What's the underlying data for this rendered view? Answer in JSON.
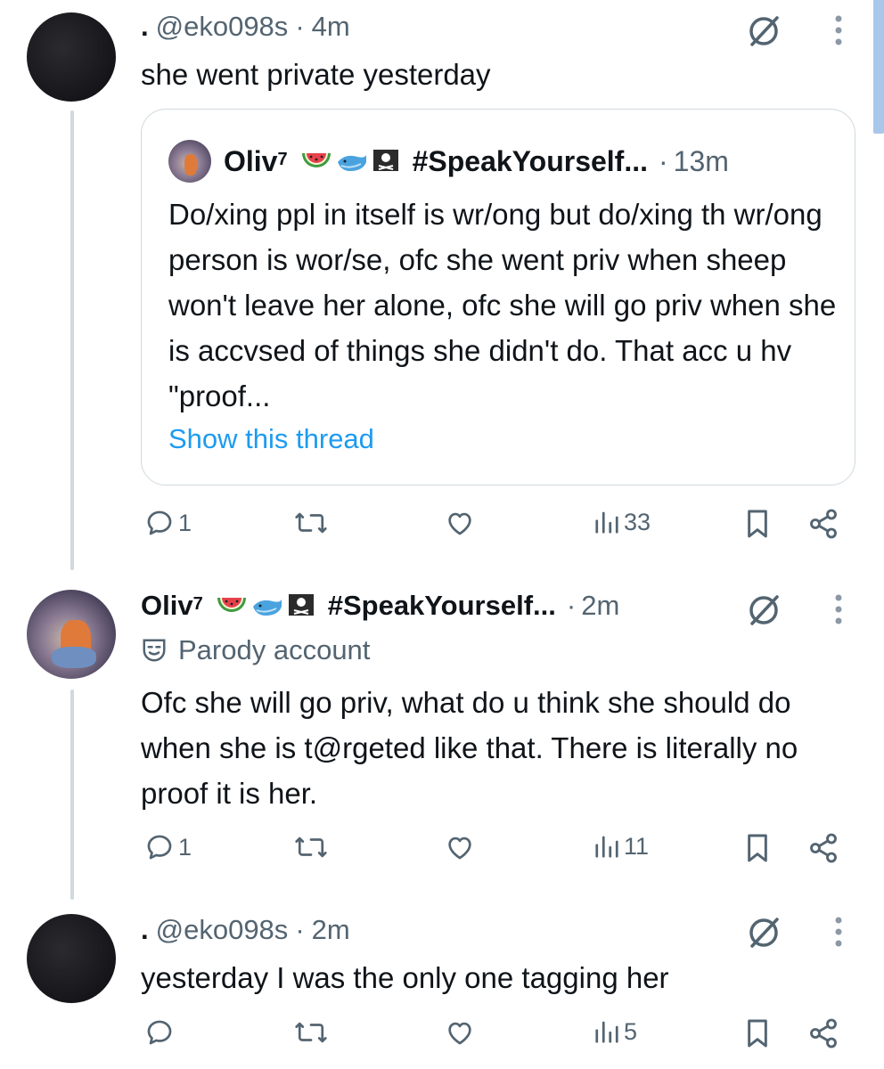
{
  "tweets": [
    {
      "display_name": ".",
      "handle": "@eko098s",
      "time": "4m",
      "text": "she went private yesterday",
      "quote": {
        "display_name": "Oliv",
        "sup": "7",
        "hashtag": "#SpeakYourself...",
        "time": "13m",
        "text": "Do/xing ppl in itself is wr/ong but do/xing th wr/ong person is wor/se, ofc she went priv when sheep won't leave her alone, ofc she will go priv when she is accvsed of things she didn't do. That acc u hv \"proof...",
        "link": "Show this thread"
      },
      "replies": "1",
      "views": "33"
    },
    {
      "display_name": "Oliv",
      "sup": "7",
      "hashtag": "#SpeakYourself...",
      "time": "2m",
      "label": "Parody account",
      "text": "Ofc she will go priv, what do u think she should do when she is t@rgeted like that. There is literally no proof it is her.",
      "replies": "1",
      "views": "11"
    },
    {
      "display_name": ".",
      "handle": "@eko098s",
      "time": "2m",
      "text": "yesterday I was the only one tagging her",
      "views": "5"
    }
  ],
  "separator": "·",
  "colors": {
    "text": "#0f1419",
    "muted": "#536471",
    "link": "#1d9bf0",
    "border": "#cfd9de"
  },
  "icons": [
    "grok-icon",
    "more-icon",
    "reply-icon",
    "retweet-icon",
    "like-icon",
    "views-icon",
    "bookmark-icon",
    "share-icon",
    "watermelon-emoji",
    "whale-emoji",
    "pirate-flag-emoji",
    "parody-mask-icon"
  ]
}
